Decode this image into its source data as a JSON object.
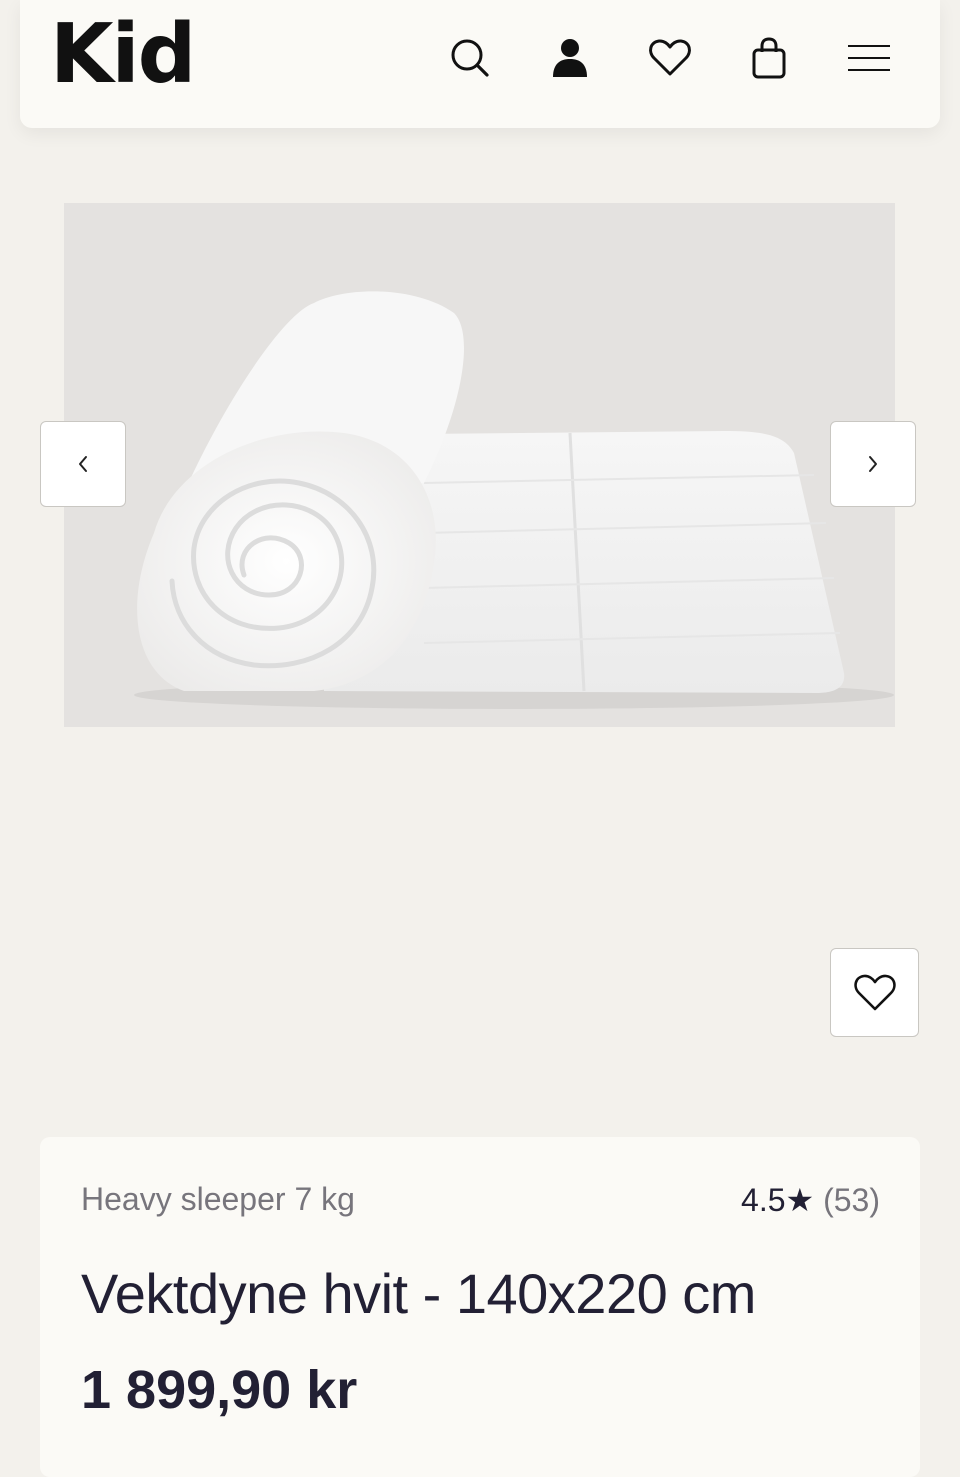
{
  "header": {
    "logo": "Kid",
    "icons": [
      "search-icon",
      "account-icon",
      "heart-icon",
      "bag-icon",
      "menu-icon"
    ]
  },
  "gallery": {
    "image_alt": "Vektdyne hvit rolled weighted blanket",
    "prev_label": "‹",
    "next_label": "›"
  },
  "product": {
    "brand": "Heavy sleeper 7 kg",
    "rating": "4.5",
    "rating_star": "★",
    "review_count": "(53)",
    "title": "Vektdyne hvit - 140x220 cm",
    "price": "1 899,90 kr"
  },
  "colors": {
    "background": "#f3f1ec",
    "card": "#fbfaf6",
    "text": "#222034",
    "muted": "#77757c"
  }
}
